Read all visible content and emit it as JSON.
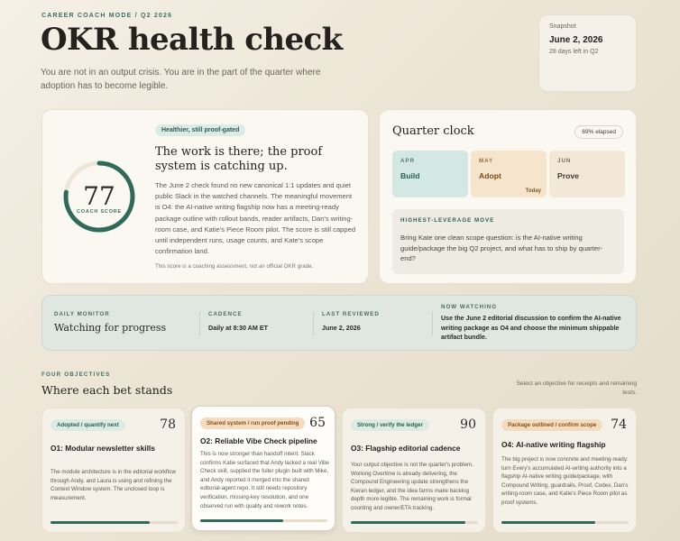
{
  "header": {
    "eyebrow": "CAREER COACH MODE / Q2 2026",
    "title": "OKR health check",
    "subtitle": "You are not in an output crisis. You are in the part of the quarter where adoption has to become legible."
  },
  "snapshot": {
    "label": "Snapshot",
    "date": "June 2, 2026",
    "days_left": "28 days left in Q2"
  },
  "score_card": {
    "score": "77",
    "score_value": 77,
    "score_label": "COACH SCORE",
    "pill": "Healthier, still proof-gated",
    "headline": "The work is there; the proof system is catching up.",
    "body": "The June 2 check found no new canonical 1:1 updates and quiet public Slack in the watched channels. The meaningful movement is O4: the AI-native writing flagship now has a meeting-ready package outline with rollout bands, reader artifacts, Dan's writing-room case, and Katie's Piece Room pilot. The score is still capped until independent runs, usage counts, and Kate's scope confirmation land.",
    "note": "This score is a coaching assessment, not an official OKR grade.",
    "ring_color": "#2f6a5b"
  },
  "quarter_clock": {
    "title": "Quarter clock",
    "elapsed": "69% elapsed",
    "months": [
      {
        "month": "APR",
        "name": "Build",
        "tag": ""
      },
      {
        "month": "MAY",
        "name": "Adopt",
        "tag": "Today"
      },
      {
        "month": "JUN",
        "name": "Prove",
        "tag": ""
      }
    ],
    "move_heading": "HIGHEST-LEVERAGE MOVE",
    "move_body": "Bring Kate one clean scope question: is the AI-native writing guide/package the big Q2 project, and what has to ship by quarter-end?"
  },
  "monitor": {
    "daily_label": "DAILY MONITOR",
    "daily_value": "Watching for progress",
    "cadence_label": "CADENCE",
    "cadence_value": "Daily at 8:30 AM ET",
    "reviewed_label": "LAST REVIEWED",
    "reviewed_value": "June 2, 2026",
    "watching_label": "NOW WATCHING",
    "watching_value": "Use the June 2 editorial discussion to confirm the AI-native writing package as O4 and choose the minimum shippable artifact bundle."
  },
  "objectives": {
    "eyebrow": "FOUR OBJECTIVES",
    "title": "Where each bet stands",
    "hint": "Select an objective for receipts and remaining tests.",
    "items": [
      {
        "pill": "Adopted / quantify next",
        "score": "78",
        "progress": 0.78,
        "name": "O1: Modular newsletter skills",
        "desc": "The module architecture is in the editorial workflow through Andy, and Laura is using and refining the Context Window system. The unclosed loop is measurement."
      },
      {
        "pill": "Shared system / run proof pending",
        "score": "65",
        "progress": 0.65,
        "name": "O2: Reliable Vibe Check pipeline",
        "desc": "This is now stronger than handoff intent: Slack confirms Katie surfaced that Andy lacked a real Vibe Check skill, supplied the fuller plugin built with Mike, and Andy reported it merged into the shared editorial-agent repo. It still needs repository verification, missing-key resolution, and one observed run with quality and rework notes."
      },
      {
        "pill": "Strong / verify the ledger",
        "score": "90",
        "progress": 0.9,
        "name": "O3: Flagship editorial cadence",
        "desc": "Your output objective is not the quarter's problem. Working Overtime is already delivering, the Compound Engineering update strengthens the Kieran ledger, and the idea farms make backlog depth more legible. The remaining work is formal counting and owner/ETA tracking."
      },
      {
        "pill": "Package outlined / confirm scope",
        "score": "74",
        "progress": 0.74,
        "name": "O4: AI-native writing flagship",
        "desc": "The big project is now concrete and meeting-ready: turn Every's accumulated AI-writing authority into a flagship AI-native writing guide/package, with Compound Writing, guardrails, Proof, Codex, Dan's writing-room case, and Katie's Piece Room pilot as proof systems."
      }
    ]
  }
}
